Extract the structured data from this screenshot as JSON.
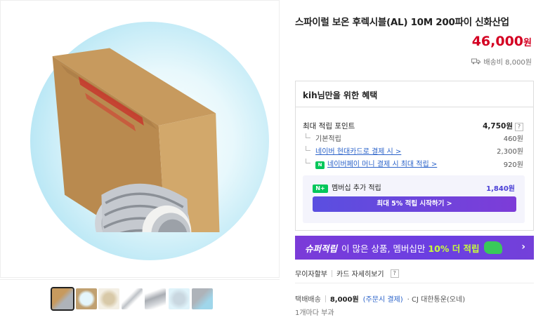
{
  "product": {
    "title": "스파이럴 보온 후렉시블(AL) 10M 200파이 신화산업",
    "price": "46,000",
    "price_unit": "원",
    "shipping_summary": "배송비 8,000원"
  },
  "benefit": {
    "heading": "kih님만을 위한 혜택",
    "max_label": "최대 적립 포인트",
    "max_value": "4,750원",
    "rows": [
      {
        "label": "기본적립",
        "value": "460원"
      },
      {
        "label": "네이버 현대카드로 결제 시 >",
        "value": "2,300원"
      },
      {
        "label": "네이버페이 머니 결제 시 최대 적립 >",
        "value": "920원"
      }
    ],
    "member_label": "멤버십 추가 적립",
    "member_value": "1,840원",
    "member_button": "최대 5% 적립 시작하기 >",
    "npay_badge": "N",
    "nplus_badge": "N+",
    "help_mark": "?"
  },
  "super": {
    "brand": "슈퍼적립",
    "text": "이 많은 상품, 멤버십만",
    "highlight": "10% 더 적립",
    "chevron": "›"
  },
  "card_links": {
    "installment": "무이자할부",
    "card_detail": "카드 자세히보기",
    "help_mark": "?"
  },
  "shipping": {
    "label": "택배배송",
    "fee": "8,000원",
    "fee_note": "(주문시 결제)",
    "carrier": "· CJ 대한통운(오네)",
    "per_unit": "1개마다 부과"
  },
  "icons": {
    "truck": "truck-icon"
  },
  "colors": {
    "price_red": "#d40022",
    "accent_purple": "#6a3fe2",
    "naver_green": "#03c75a",
    "link_blue": "#2a62c9"
  },
  "thumbnails_count": 7,
  "selected_thumbnail": 1
}
